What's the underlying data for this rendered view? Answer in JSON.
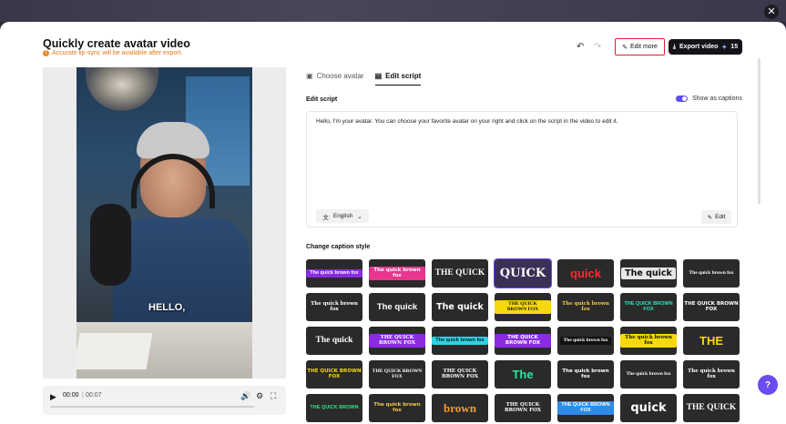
{
  "header": {
    "title": "Quickly create avatar video",
    "warning": "Accurate lip-sync will be available after export.",
    "edit_more": "Edit more",
    "export": "Export video",
    "export_credits": "15"
  },
  "player": {
    "caption_overlay": "HELLO,",
    "current_time": "00:00",
    "separator": "|",
    "duration": "00:07",
    "progress": 0
  },
  "tabs": [
    {
      "label": "Choose avatar"
    },
    {
      "label": "Edit script"
    }
  ],
  "script": {
    "label": "Edit script",
    "captions_toggle": "Show as captions",
    "text": "Hello, I'm your avatar. You can choose your favorite avatar on your right and click on the script in the video to edit it.",
    "language": "English",
    "edit_label": "Edit"
  },
  "caption_styles": {
    "label": "Change caption style",
    "items": [
      {
        "text": "The quick brown fox",
        "bg": "#2a2a2a",
        "color": "#ffffff",
        "hl": "#8a2be2"
      },
      {
        "text": "The quick brown fox",
        "bg": "#2a2a2a",
        "color": "#ffffff",
        "hl": "#e8368f"
      },
      {
        "text": "THE QUICK",
        "bg": "#2a2a2a",
        "color": "#ffffff",
        "hl": ""
      },
      {
        "text": "QUICK",
        "bg": "#3a2f55",
        "color": "#ffffff",
        "hl": ""
      },
      {
        "text": "quick",
        "bg": "#2a2a2a",
        "color": "#ff2b2b",
        "hl": ""
      },
      {
        "text": "The quick",
        "bg": "#2a2a2a",
        "color": "#111111",
        "hl": "#e6e6e6"
      },
      {
        "text": "The quick brown fox",
        "bg": "#2a2a2a",
        "color": "#ffffff",
        "hl": ""
      },
      {
        "text": "The quick brown fox",
        "bg": "#2a2a2a",
        "color": "#ffffff",
        "hl": ""
      },
      {
        "text": "The quick",
        "bg": "#2a2a2a",
        "color": "#ffffff",
        "hl": ""
      },
      {
        "text": "The quick",
        "bg": "#2a2a2a",
        "color": "#ffffff",
        "hl": ""
      },
      {
        "text": "THE QUICK BROWN FOX",
        "bg": "#2a2a2a",
        "color": "#111111",
        "hl": "#f5d90a"
      },
      {
        "text": "The quick brown fox",
        "bg": "#2a2a2a",
        "color": "#f2c94c",
        "hl": ""
      },
      {
        "text": "THE QUICK BROWN FOX",
        "bg": "#2a2a2a",
        "color": "#2ee6c8",
        "hl": ""
      },
      {
        "text": "THE QUICK BROWN FOX",
        "bg": "#2a2a2a",
        "color": "#ffffff",
        "hl": ""
      },
      {
        "text": "The quick",
        "bg": "#2a2a2a",
        "color": "#ffffff",
        "hl": ""
      },
      {
        "text": "THE QUICK BROWN FOX",
        "bg": "#2a2a2a",
        "color": "#ffffff",
        "hl": "#8a2be2"
      },
      {
        "text": "The quick brown fox",
        "bg": "#2a2a2a",
        "color": "#111111",
        "hl": "#2ed3e6"
      },
      {
        "text": "THE QUICK BROWN FOX",
        "bg": "#2a2a2a",
        "color": "#ffffff",
        "hl": "#8a2be2"
      },
      {
        "text": "The quick brown fox",
        "bg": "#2a2a2a",
        "color": "#ffffff",
        "hl": "#111111"
      },
      {
        "text": "The quick brown fox",
        "bg": "#2a2a2a",
        "color": "#111111",
        "hl": "#f5d90a"
      },
      {
        "text": "THE",
        "bg": "#2a2a2a",
        "color": "#f5d90a",
        "hl": ""
      },
      {
        "text": "THE QUICK BROWN FOX",
        "bg": "#2a2a2a",
        "color": "#f5d90a",
        "hl": ""
      },
      {
        "text": "THE QUICK BROWN FOX",
        "bg": "#2a2a2a",
        "color": "#ffffff",
        "hl": ""
      },
      {
        "text": "THE QUICK BROWN FOX",
        "bg": "#2a2a2a",
        "color": "#ffffff",
        "hl": ""
      },
      {
        "text": "The",
        "bg": "#2a2a2a",
        "color": "#2ee6a0",
        "hl": ""
      },
      {
        "text": "The quick brown fox",
        "bg": "#2a2a2a",
        "color": "#ffffff",
        "hl": ""
      },
      {
        "text": "The quick brown fox",
        "bg": "#2a2a2a",
        "color": "#ffffff",
        "hl": ""
      },
      {
        "text": "The quick brown fox",
        "bg": "#2a2a2a",
        "color": "#ffffff",
        "hl": ""
      },
      {
        "text": "THE QUICK BROWN",
        "bg": "#2a2a2a",
        "color": "#2ee67a",
        "hl": ""
      },
      {
        "text": "The quick brown fox",
        "bg": "#2a2a2a",
        "color": "#f2c94c",
        "hl": ""
      },
      {
        "text": "brown",
        "bg": "#2a2a2a",
        "color": "#f29a2e",
        "hl": ""
      },
      {
        "text": "THE QUICK BROWN FOX",
        "bg": "#2a2a2a",
        "color": "#ffffff",
        "hl": ""
      },
      {
        "text": "THE QUICK BROWN FOX",
        "bg": "#2a2a2a",
        "color": "#ffffff",
        "hl": "#2e8be6"
      },
      {
        "text": "quick",
        "bg": "#2a2a2a",
        "color": "#ffffff",
        "hl": ""
      },
      {
        "text": "THE QUICK",
        "bg": "#2a2a2a",
        "color": "#ffffff",
        "hl": ""
      }
    ]
  }
}
